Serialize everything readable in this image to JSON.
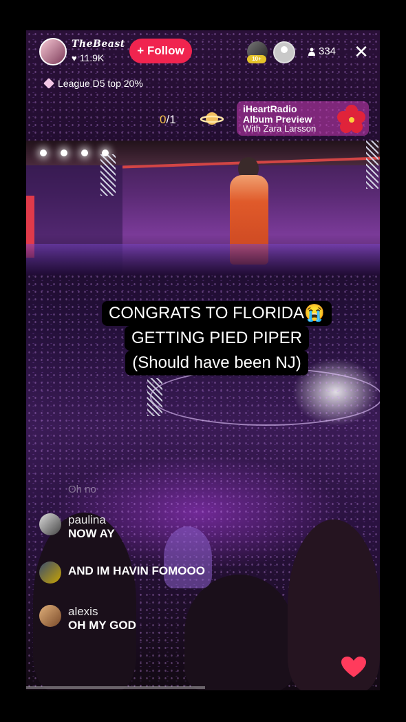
{
  "host": {
    "name": "TheBeast",
    "likes": "11.9K",
    "follow_label": "+ Follow"
  },
  "viewers": {
    "badge": "10+",
    "count": "334"
  },
  "league": {
    "text": "League D5 top 20%"
  },
  "pager": {
    "current": "0",
    "total": "/1"
  },
  "promo": {
    "line1": "iHeartRadio",
    "line2": "Album Preview",
    "line3": "With Zara Larsson"
  },
  "caption": {
    "lines": [
      "CONGRATS TO FLORIDA😭",
      "GETTING PIED PIPER",
      "(Should have been NJ)"
    ]
  },
  "comments": {
    "faint": "Oh no",
    "items": [
      {
        "user": "paulina",
        "message": "NOW AY"
      },
      {
        "user": "",
        "message": "AND IM HAVIN FOMOOO"
      },
      {
        "user": "alexis",
        "message": "OH MY GOD"
      }
    ]
  },
  "colors": {
    "follow": "#f0244f",
    "accent": "#f6c24a",
    "heart": "#ff3b5c",
    "promo": "#c83cb4"
  },
  "icons": [
    "heart-icon",
    "person-icon",
    "close-icon",
    "diamond-icon",
    "planet-icon",
    "hibiscus-icon",
    "heart-like-icon"
  ]
}
